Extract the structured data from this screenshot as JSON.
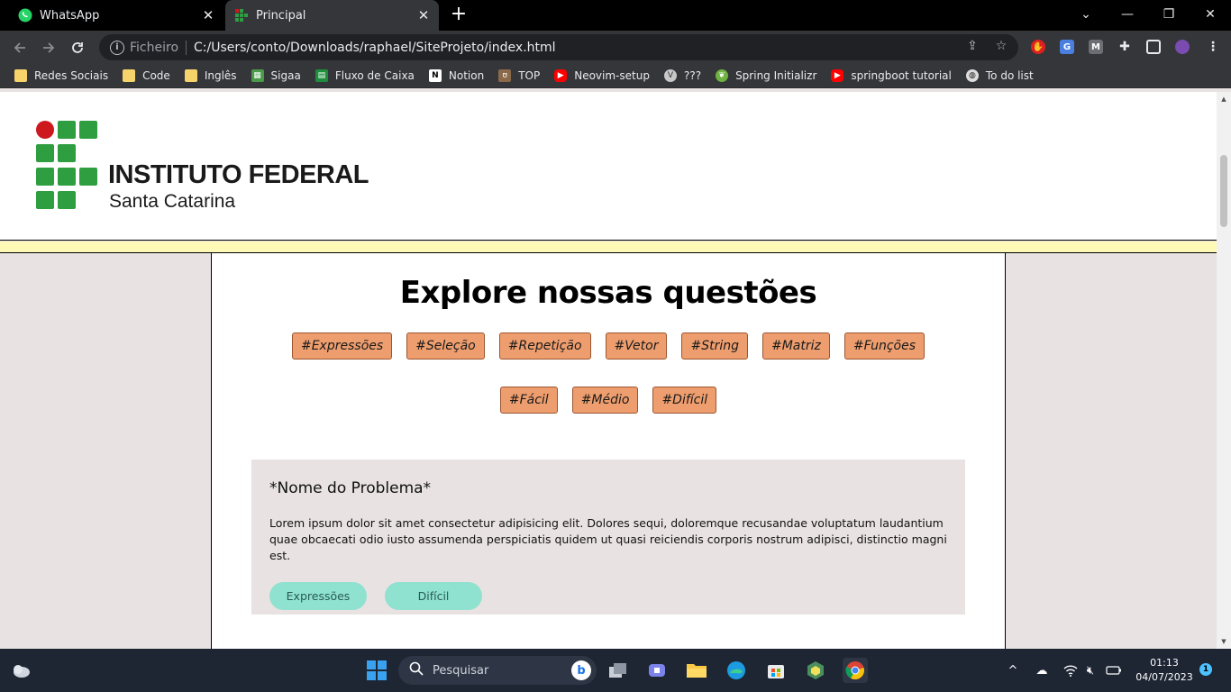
{
  "browser": {
    "tabs": [
      {
        "title": "WhatsApp",
        "active": false,
        "icon": "whatsapp-icon"
      },
      {
        "title": "Principal",
        "active": true,
        "icon": "ifsc-favicon-icon"
      }
    ],
    "address": {
      "chip": "Ficheiro",
      "url": "C:/Users/conto/Downloads/raphael/SiteProjeto/index.html"
    },
    "bookmarks": [
      {
        "label": "Redes Sociais",
        "icon": "folder-icon"
      },
      {
        "label": "Code",
        "icon": "folder-icon"
      },
      {
        "label": "Inglês",
        "icon": "folder-icon"
      },
      {
        "label": "Sigaa",
        "icon": "sigaa-icon"
      },
      {
        "label": "Fluxo de Caixa",
        "icon": "sheets-icon"
      },
      {
        "label": "Notion",
        "icon": "notion-icon"
      },
      {
        "label": "TOP",
        "icon": "top-icon"
      },
      {
        "label": "Neovim-setup",
        "icon": "youtube-icon"
      },
      {
        "label": "???",
        "icon": "vue-icon"
      },
      {
        "label": "Spring Initializr",
        "icon": "spring-icon"
      },
      {
        "label": "springboot tutorial",
        "icon": "youtube-icon"
      },
      {
        "label": "To do list",
        "icon": "globe-icon"
      }
    ]
  },
  "site": {
    "logo": {
      "title": "INSTITUTO FEDERAL",
      "subtitle": "Santa Catarina"
    },
    "heading": "Explore nossas questões",
    "topic_tags": [
      "#Expressões",
      "#Seleção",
      "#Repetição",
      "#Vetor",
      "#String",
      "#Matriz",
      "#Funções"
    ],
    "difficulty_tags": [
      "#Fácil",
      "#Médio",
      "#Difícil"
    ],
    "problem_card": {
      "title": "*Nome do Problema*",
      "description": "Lorem ipsum dolor sit amet consectetur adipisicing elit. Dolores sequi, doloremque recusandae voluptatum laudantium quae obcaecati odio iusto assumenda perspiciatis quidem ut quasi reiciendis corporis nostrum adipisci, distinctio magni est.",
      "pills": [
        "Expressões",
        "Difícil"
      ]
    },
    "colors": {
      "tag": "#ee9e6e",
      "pill": "#8ee2cf",
      "band": "#fff9b8",
      "logo_green": "#2f9e41",
      "logo_red": "#cd191e"
    }
  },
  "taskbar": {
    "search_placeholder": "Pesquisar",
    "time": "01:13",
    "date": "04/07/2023",
    "notification_count": "1"
  }
}
